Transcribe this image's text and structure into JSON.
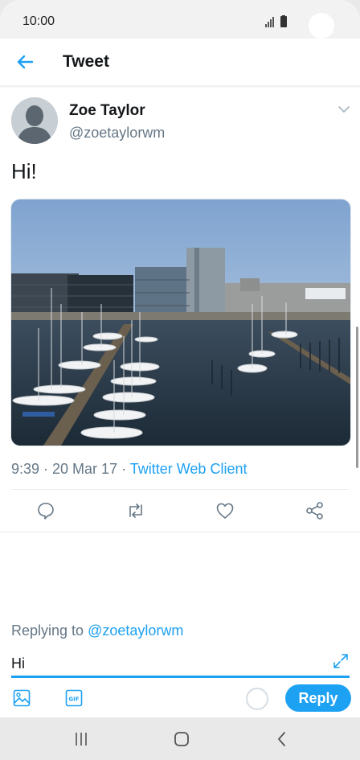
{
  "status_bar": {
    "time": "10:00"
  },
  "header": {
    "title": "Tweet",
    "back_icon": "arrow-left-icon"
  },
  "tweet": {
    "author_name": "Zoe Taylor",
    "author_handle": "@zoetaylorwm",
    "text": "Hi!",
    "time_date": "9:39 · 20 Mar 17 · ",
    "client": "Twitter Web Client",
    "photo_subject": "marina-harbor-photo"
  },
  "actions": {
    "reply_icon": "comment-icon",
    "retweet_icon": "retweet-icon",
    "like_icon": "heart-icon",
    "share_icon": "share-icon"
  },
  "reply_box": {
    "replying_prefix": "Replying to ",
    "replying_handle": "@zoetaylorwm",
    "input_value": "Hi",
    "reply_label": "Reply"
  },
  "colors": {
    "accent": "#1da1f2",
    "secondary_text": "#657786"
  }
}
